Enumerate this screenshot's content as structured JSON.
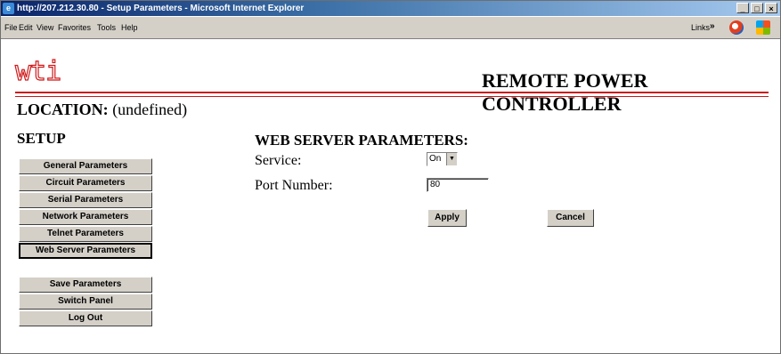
{
  "window": {
    "title": "http://207.212.30.80 - Setup Parameters - Microsoft Internet Explorer",
    "controls": [
      "_",
      "□",
      "×"
    ]
  },
  "menubar": {
    "items": [
      "File",
      "Edit",
      "View",
      "Favorites",
      "Tools",
      "Help"
    ],
    "links_label": "Links",
    "chevron": "»"
  },
  "header": {
    "logo_text": "wti",
    "title": "REMOTE POWER CONTROLLER",
    "accent_color": "#c81818"
  },
  "location": {
    "label": "LOCATION:",
    "value": "(undefined)"
  },
  "sidebar": {
    "heading": "SETUP",
    "items": [
      {
        "label": "General Parameters"
      },
      {
        "label": "Circuit Parameters"
      },
      {
        "label": "Serial Parameters"
      },
      {
        "label": "Network Parameters"
      },
      {
        "label": "Telnet Parameters"
      },
      {
        "label": "Web Server Parameters",
        "active": true
      }
    ],
    "actions": [
      {
        "label": "Save Parameters"
      },
      {
        "label": "Switch Panel"
      },
      {
        "label": "Log Out"
      }
    ]
  },
  "main": {
    "title": "WEB SERVER PARAMETERS:",
    "service_label": "Service:",
    "service_value": "On",
    "port_label": "Port Number:",
    "port_value": "80",
    "apply_label": "Apply",
    "cancel_label": "Cancel"
  }
}
